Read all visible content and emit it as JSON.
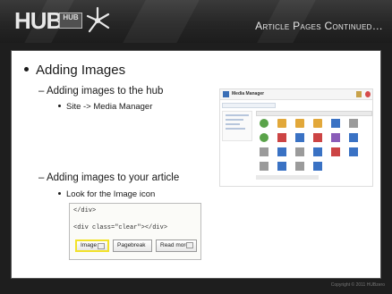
{
  "header": {
    "logo_text": "HUB",
    "logo_box_text": "HUB",
    "section_title": "Article Pages Continued…"
  },
  "slide": {
    "bullet1": "Adding Images",
    "bullet1_sub1": "– Adding images to the hub",
    "bullet1_sub1_point": "Site -> Media Manager",
    "bullet1_sub2": "– Adding images to your article",
    "bullet1_sub2_point": "Look for the Image icon"
  },
  "media_manager": {
    "title": "Media Manager"
  },
  "editor": {
    "code_line1": "</div>",
    "code_line2": "<div class=\"clear\"></div>",
    "btn_image": "Image",
    "btn_pagebreak": "Pagebreak",
    "btn_readmore": "Read more..."
  },
  "footer": {
    "copyright": "Copyright © 2011 HUBzero"
  },
  "colors": {
    "header_bg": "#262626",
    "content_bg": "#ffffff",
    "highlight": "#f2e22a"
  }
}
